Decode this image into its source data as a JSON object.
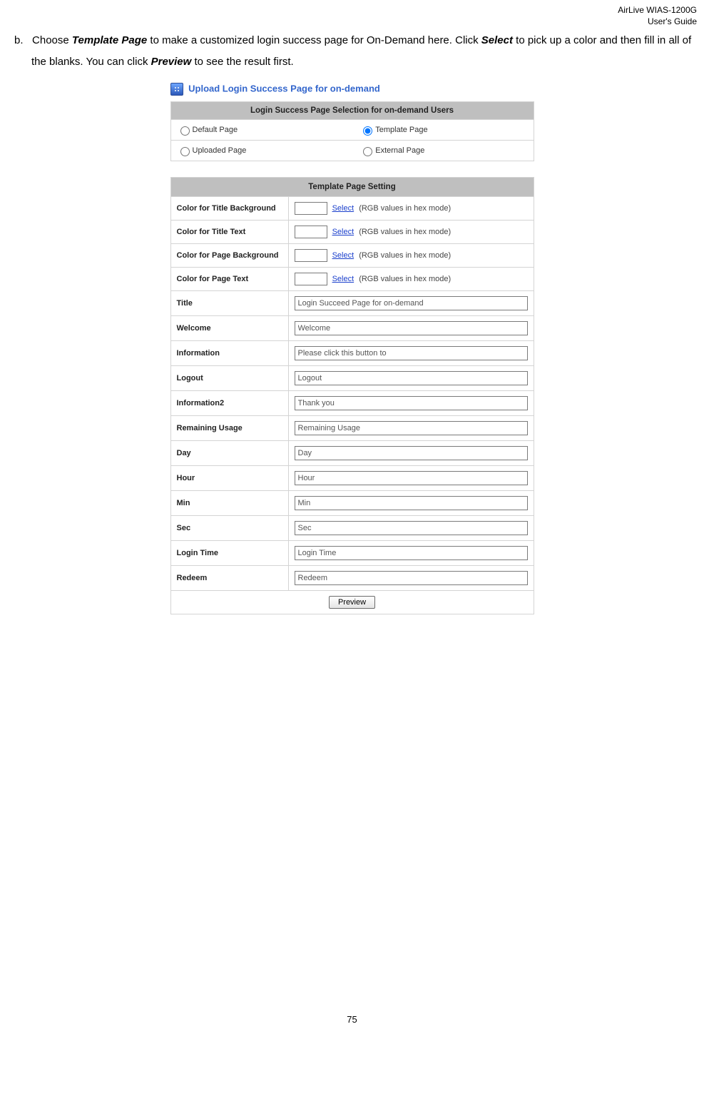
{
  "header": {
    "product": "AirLive WIAS-1200G",
    "subtitle": "User's Guide"
  },
  "instruction": {
    "bullet": "b.",
    "text1": "Choose ",
    "bold1": "Template Page",
    "text2": " to make a customized login success page for On-Demand here. Click ",
    "bold2": "Select",
    "text3": " to pick up a color and then fill in all of the blanks. You can click ",
    "bold3": "Preview",
    "text4": " to see the result first."
  },
  "panel": {
    "title": "Upload Login Success Page for on-demand",
    "selection_header": "Login Success Page Selection for on-demand Users",
    "options": {
      "default": "Default Page",
      "template": "Template Page",
      "uploaded": "Uploaded Page",
      "external": "External Page"
    }
  },
  "template": {
    "header": "Template Page Setting",
    "rows": {
      "title_bg": {
        "label": "Color for Title Background",
        "link": "Select",
        "hint": "(RGB values in hex mode)"
      },
      "title_txt": {
        "label": "Color for Title Text",
        "link": "Select",
        "hint": "(RGB values in hex mode)"
      },
      "page_bg": {
        "label": "Color for Page Background",
        "link": "Select",
        "hint": "(RGB values in hex mode)"
      },
      "page_txt": {
        "label": "Color for Page Text",
        "link": "Select",
        "hint": "(RGB values in hex mode)"
      },
      "title": {
        "label": "Title",
        "value": "Login Succeed Page for on-demand"
      },
      "welcome": {
        "label": "Welcome",
        "value": "Welcome"
      },
      "information": {
        "label": "Information",
        "value": "Please click this button to"
      },
      "logout": {
        "label": "Logout",
        "value": "Logout"
      },
      "information2": {
        "label": "Information2",
        "value": "Thank you"
      },
      "remaining": {
        "label": "Remaining Usage",
        "value": "Remaining Usage"
      },
      "day": {
        "label": "Day",
        "value": "Day"
      },
      "hour": {
        "label": "Hour",
        "value": "Hour"
      },
      "min": {
        "label": "Min",
        "value": "Min"
      },
      "sec": {
        "label": "Sec",
        "value": "Sec"
      },
      "login_time": {
        "label": "Login Time",
        "value": "Login Time"
      },
      "redeem": {
        "label": "Redeem",
        "value": "Redeem"
      }
    },
    "preview_btn": "Preview"
  },
  "footer": {
    "page_number": "75"
  }
}
